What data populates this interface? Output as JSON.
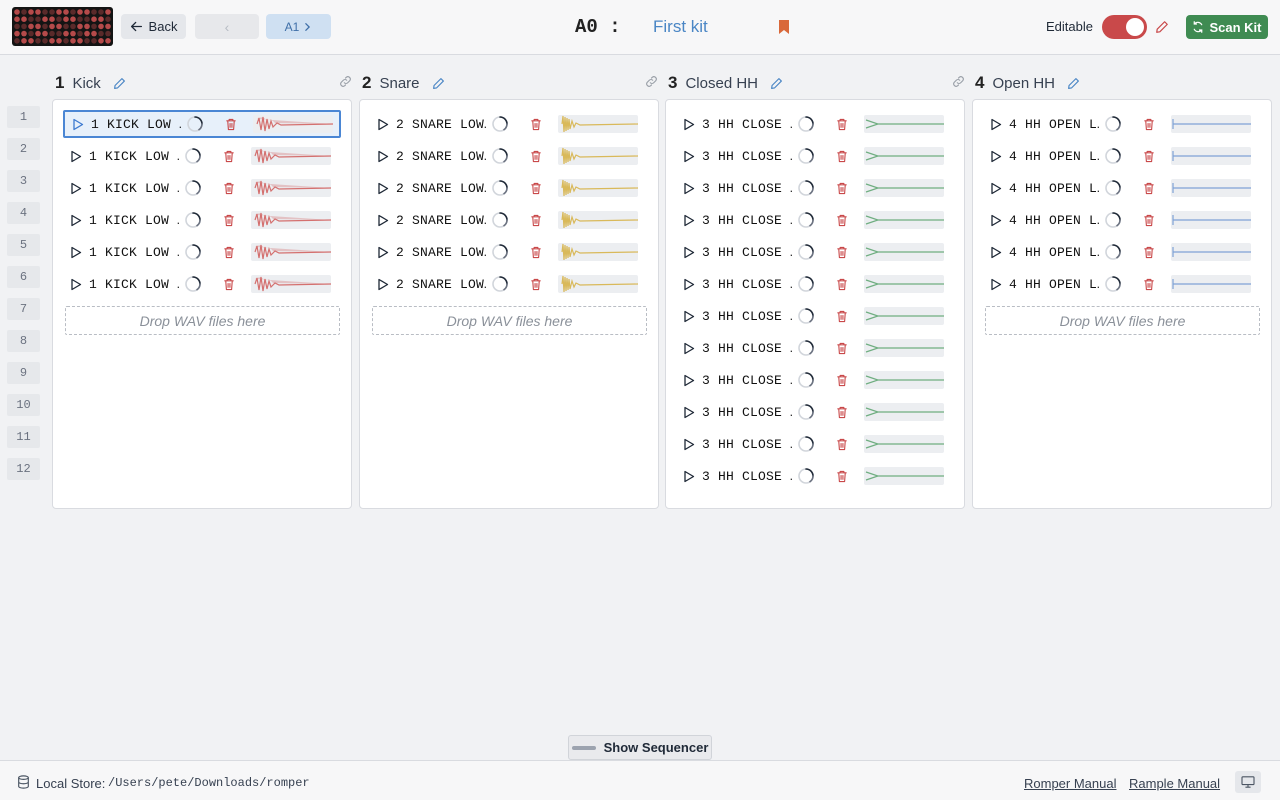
{
  "header": {
    "back_label": "Back",
    "prev_label": "‹",
    "next_label": "A1",
    "kit_slot": "A0 :",
    "kit_name": "First kit",
    "editable_label": "Editable",
    "editable_on": true,
    "scan_label": "Scan Kit"
  },
  "rows": [
    "1",
    "2",
    "3",
    "4",
    "5",
    "6",
    "7",
    "8",
    "9",
    "10",
    "11",
    "12"
  ],
  "voices": [
    {
      "number": "1",
      "name": "Kick",
      "wave_color": "#d4706f",
      "samples": [
        "1 KICK LOW …",
        "1 KICK LOW …",
        "1 KICK LOW …",
        "1 KICK LOW …",
        "1 KICK LOW …",
        "1 KICK LOW …"
      ],
      "drop_label": "Drop WAV files here"
    },
    {
      "number": "2",
      "name": "Snare",
      "wave_color": "#d9b95a",
      "samples": [
        "2 SNARE LOW…",
        "2 SNARE LOW…",
        "2 SNARE LOW…",
        "2 SNARE LOW…",
        "2 SNARE LOW…",
        "2 SNARE LOW…"
      ],
      "drop_label": "Drop WAV files here"
    },
    {
      "number": "3",
      "name": "Closed HH",
      "wave_color": "#6fae80",
      "samples": [
        "3 HH CLOSE …",
        "3 HH CLOSE …",
        "3 HH CLOSE …",
        "3 HH CLOSE …",
        "3 HH CLOSE …",
        "3 HH CLOSE …",
        "3 HH CLOSE …",
        "3 HH CLOSE …",
        "3 HH CLOSE …",
        "3 HH CLOSE …",
        "3 HH CLOSE …",
        "3 HH CLOSE …"
      ],
      "drop_label": ""
    },
    {
      "number": "4",
      "name": "Open HH",
      "wave_color": "#7fa2d6",
      "samples": [
        "4 HH OPEN L…",
        "4 HH OPEN L…",
        "4 HH OPEN L…",
        "4 HH OPEN L…",
        "4 HH OPEN L…",
        "4 HH OPEN L…"
      ],
      "drop_label": "Drop WAV files here"
    }
  ],
  "selected_sample": {
    "voice": 0,
    "index": 0
  },
  "sequencer": {
    "label": "Show Sequencer"
  },
  "footer": {
    "store_label": "Local Store:",
    "store_path": "/Users/pete/Downloads/romper",
    "link1": "Romper Manual",
    "link2": "Rample Manual"
  },
  "colors": {
    "accent": "#4a86c5",
    "danger": "#c9494a",
    "success": "#3f8b52",
    "bookmark": "#d9683a"
  }
}
